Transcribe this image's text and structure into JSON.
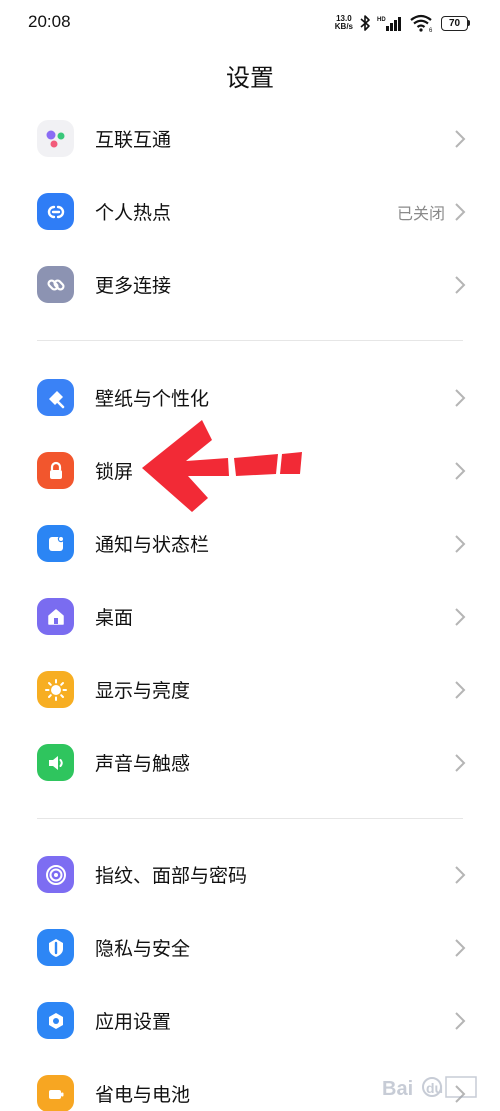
{
  "status_bar": {
    "time": "20:08",
    "net_speed_value": "13.0",
    "net_speed_unit": "KB/s",
    "battery": "70"
  },
  "page": {
    "title": "设置"
  },
  "groups": [
    {
      "items": [
        {
          "label": "互联互通",
          "icon": "interconnect-icon",
          "status": ""
        },
        {
          "label": "个人热点",
          "icon": "hotspot-icon",
          "color": "#2f7df6",
          "status": "已关闭"
        },
        {
          "label": "更多连接",
          "icon": "more-connections-icon",
          "color": "#8c93b2",
          "status": ""
        }
      ]
    },
    {
      "items": [
        {
          "label": "壁纸与个性化",
          "icon": "wallpaper-icon",
          "color": "#3a82f6"
        },
        {
          "label": "锁屏",
          "icon": "lock-icon",
          "color": "#f2562d"
        },
        {
          "label": "通知与状态栏",
          "icon": "notification-icon",
          "color": "#2b85f4"
        },
        {
          "label": "桌面",
          "icon": "home-icon",
          "color": "#7a6cf0"
        },
        {
          "label": "显示与亮度",
          "icon": "brightness-icon",
          "color": "#f7ae22"
        },
        {
          "label": "声音与触感",
          "icon": "sound-icon",
          "color": "#2fc55e"
        }
      ]
    },
    {
      "items": [
        {
          "label": "指纹、面部与密码",
          "icon": "fingerprint-icon",
          "color": "#7d6df2"
        },
        {
          "label": "隐私与安全",
          "icon": "privacy-icon",
          "color": "#2d86f5"
        },
        {
          "label": "应用设置",
          "icon": "app-settings-icon",
          "color": "#2d86f5"
        },
        {
          "label": "省电与电池",
          "icon": "battery-saver-icon",
          "color": "#f7a622"
        }
      ]
    }
  ],
  "watermark": {
    "text": "Bai du 经验"
  },
  "annotation": {
    "color": "#f22a36"
  }
}
